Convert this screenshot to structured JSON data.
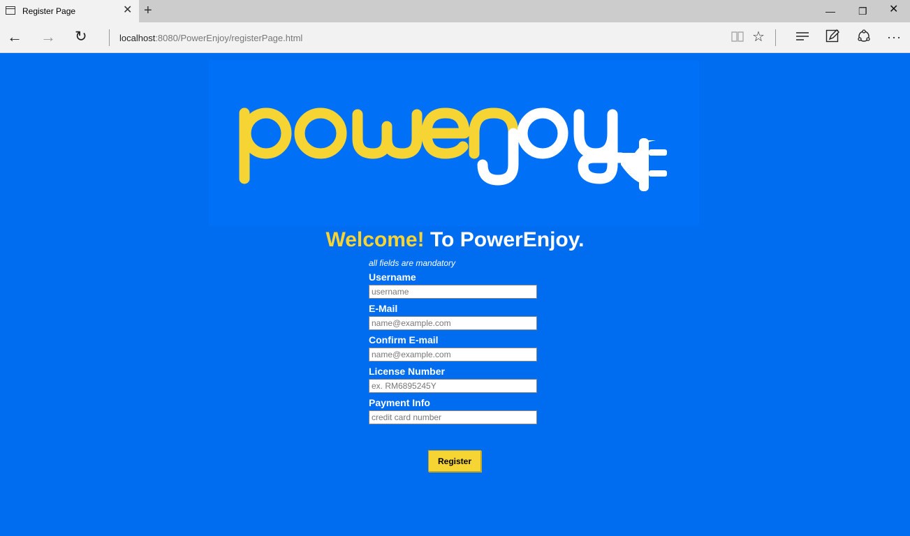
{
  "browser": {
    "tab_title": "Register Page",
    "tab_close": "✕",
    "new_tab": "+",
    "url_host": "localhost",
    "url_rest": ":8080/PowerEnjoy/registerPage.html",
    "minimize": "—",
    "maximize": "❐",
    "close": "✕",
    "back": "←",
    "forward": "→",
    "refresh": "↻",
    "reading_view": "📖",
    "favorite": "☆",
    "hub": "≡",
    "web_note": "✎",
    "share": "⟳",
    "more": "···"
  },
  "logo": {
    "text_yellow": "powen",
    "text_white": "joy",
    "colors": {
      "yellow": "#f5d433",
      "white": "#ffffff"
    }
  },
  "welcome": {
    "highlight": "Welcome!",
    "rest": " To PowerEnjoy."
  },
  "form": {
    "mandatory_note": "all fields are mandatory",
    "fields": [
      {
        "label": "Username",
        "placeholder": "username"
      },
      {
        "label": "E-Mail",
        "placeholder": "name@example.com"
      },
      {
        "label": "Confirm E-mail",
        "placeholder": "name@example.com"
      },
      {
        "label": "License Number",
        "placeholder": "ex. RM6895245Y"
      },
      {
        "label": "Payment Info",
        "placeholder": "credit card number"
      }
    ],
    "submit_label": "Register"
  },
  "colors": {
    "page_background": "#006df0",
    "accent_yellow": "#f5d433"
  }
}
